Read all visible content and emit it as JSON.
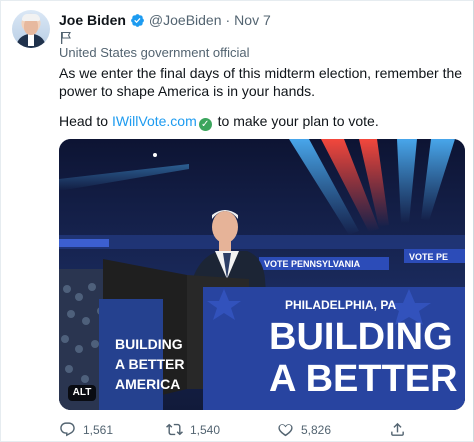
{
  "tweet": {
    "author_name": "Joe Biden",
    "handle": "@JoeBiden",
    "separator": "·",
    "date": "Nov 7",
    "affiliation": "United States government official",
    "text_line1": "As we enter the final days of this midterm election, remember the power to shape America is in your hands.",
    "text_prefix": "Head to ",
    "link": "IWillVote.com",
    "text_suffix": " to make your plan to vote.",
    "media": {
      "alt_label": "ALT",
      "sign_top": "PHILADELPHIA, PA",
      "sign_main_line1": "BUILDING",
      "sign_main_line2": "A BETTER",
      "podium_line1": "BUILDING",
      "podium_line2": "A BETTER",
      "podium_line3": "AMERICA",
      "banner_left": "VOTE PENNSYLVANIA",
      "banner_right": "VOTE PE"
    },
    "stats": {
      "replies": "1,561",
      "retweets": "1,540",
      "likes": "5,826"
    }
  },
  "icons": [
    "verified-badge-icon",
    "flag-icon",
    "check-emoji-icon",
    "reply-icon",
    "retweet-icon",
    "like-icon",
    "share-icon"
  ],
  "colors": {
    "accent": "#1d9bf0",
    "secondary_text": "#536471",
    "primary_text": "#0f1419",
    "sign_blue": "#2844a0"
  }
}
